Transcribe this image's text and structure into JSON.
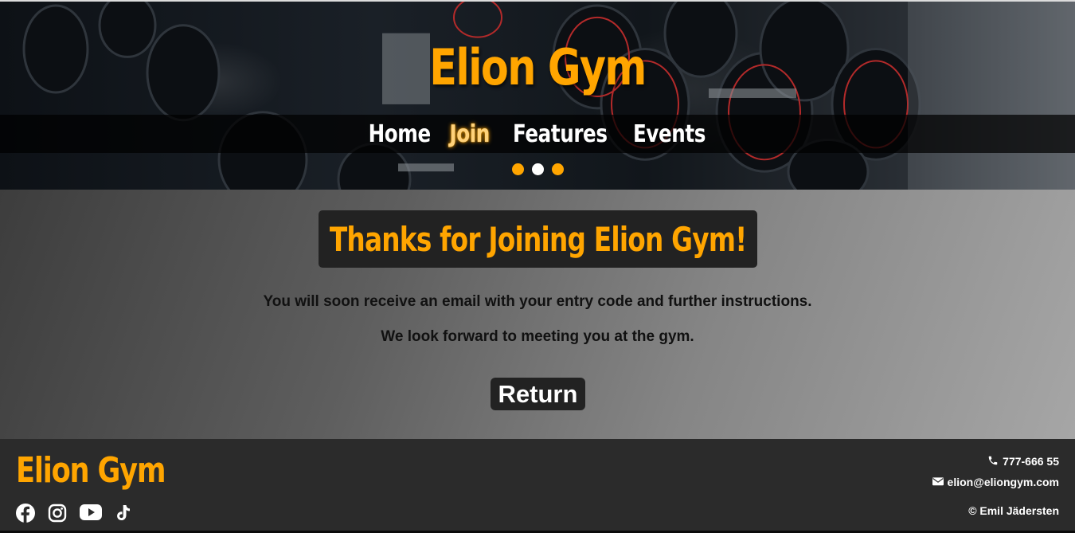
{
  "hero": {
    "title": "Elion Gym",
    "nav": [
      {
        "label": "Home"
      },
      {
        "label": "Join"
      },
      {
        "label": "Features"
      },
      {
        "label": "Events"
      }
    ],
    "active_nav": "Join",
    "slides": 3,
    "current_slide": 2
  },
  "main": {
    "heading": "Thanks for Joining Elion Gym!",
    "message1": "You will soon receive an email with your entry code and further instructions.",
    "message2": "We look forward to meeting you at the gym.",
    "return_label": "Return"
  },
  "footer": {
    "logo": "Elion Gym",
    "socials": [
      "facebook-icon",
      "instagram-icon",
      "youtube-icon",
      "tiktok-icon"
    ],
    "phone": "777-666 55",
    "email": "elion@eliongym.com",
    "copyright": "© Emil Jädersten"
  },
  "colors": {
    "accent": "#ffa500",
    "dark_panel": "#222222",
    "footer_bg": "#2b2b2b"
  }
}
